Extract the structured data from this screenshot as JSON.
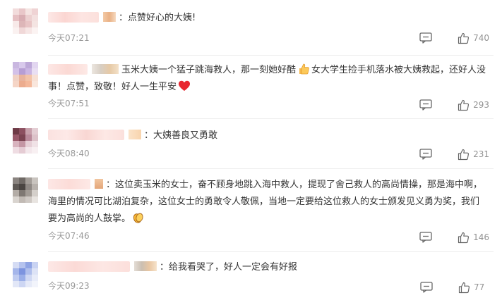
{
  "colors": {
    "text": "#333333",
    "meta": "#999999",
    "like_count": "#939393",
    "heart": "#e8262f"
  },
  "comments": [
    {
      "text_parts": [
        "：点赞好心的大姨!"
      ],
      "time": "今天07:21",
      "likes": "740",
      "reply_icon": "comment-bubble-icon",
      "like_icon": "thumbs-up-icon"
    },
    {
      "text_parts": [
        "玉米大姨一个猛子跳海救人，那一刻她好酷",
        "女大学生捡手机落水被大姨救起，还好人没事！点赞，致敬！好人一生平安"
      ],
      "emojis": [
        "thumbs-up-emoji",
        "red-heart-emoji"
      ],
      "time": "今天07:51",
      "likes": "293",
      "reply_icon": "comment-bubble-icon",
      "like_icon": "thumbs-up-icon"
    },
    {
      "text_parts": [
        "：大姨善良又勇敢"
      ],
      "time": "今天08:40",
      "likes": "231",
      "reply_icon": "comment-bubble-icon",
      "like_icon": "thumbs-up-icon"
    },
    {
      "text_parts": [
        "：这位卖玉米的女士，奋不顾身地跳入海中救人，提现了舍己救人的高尚情操，那是海中啊，海里的情况可比湖泊复杂，这位女士的勇敢令人敬佩，当地一定要给这位救人的女士颁发见义勇为奖，我们要为高尚的人鼓掌。"
      ],
      "emojis": [
        "clapping-hands-emoji"
      ],
      "time": "今天07:46",
      "likes": "146",
      "reply_icon": "comment-bubble-icon",
      "like_icon": "thumbs-up-icon"
    },
    {
      "text_parts": [
        "：给我看哭了，好人一定会有好报"
      ],
      "time": "今天09:23",
      "likes": "77",
      "reply_icon": "comment-bubble-icon",
      "like_icon": "thumbs-up-icon"
    }
  ]
}
